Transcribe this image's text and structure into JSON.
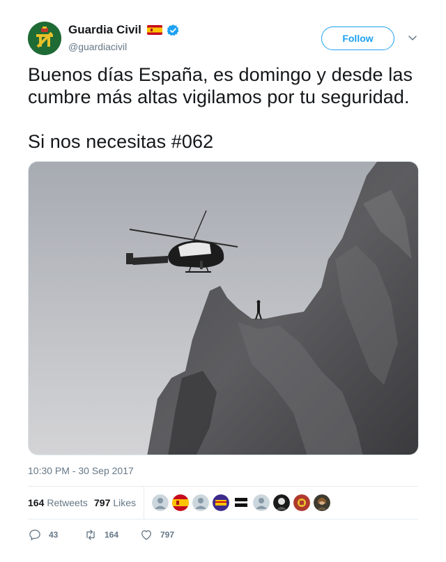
{
  "author": {
    "display_name": "Guardia Civil",
    "handle": "@guardiacivil",
    "flag_icon": "spain-flag-icon",
    "verified_icon": "verified-badge-icon",
    "follow_label": "Follow"
  },
  "tweet": {
    "line1": "Buenos días España, es domingo y desde las cumbre más altas vigilamos por tu seguridad.",
    "line2": "Si nos necesitas #062",
    "timestamp": "10:30 PM - 30 Sep 2017"
  },
  "stats": {
    "retweets_count": "164",
    "retweets_label": "Retweets",
    "likes_count": "797",
    "likes_label": "Likes"
  },
  "actions": {
    "reply_count": "43",
    "retweet_count": "164",
    "like_count": "797"
  },
  "colors": {
    "accent": "#1da1f2",
    "text": "#14171a",
    "muted": "#657786"
  }
}
